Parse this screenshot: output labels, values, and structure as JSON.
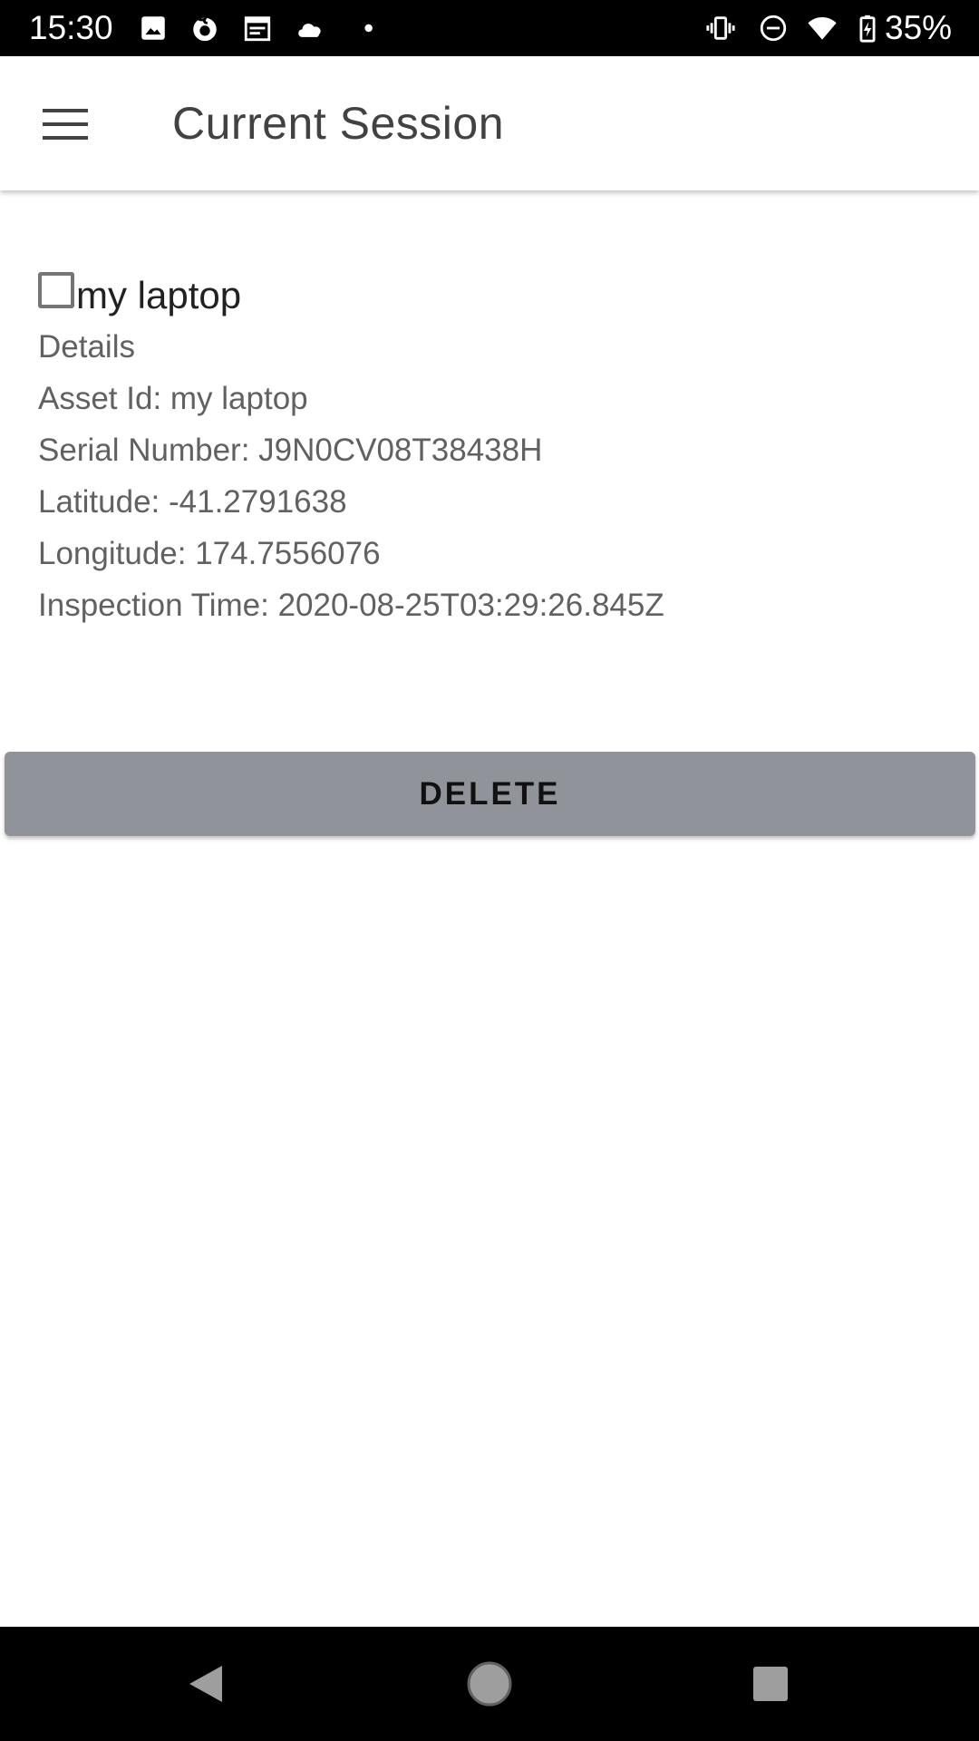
{
  "status_bar": {
    "time": "15:30",
    "battery": "35%",
    "left_icons": [
      "image-icon",
      "firefox-icon",
      "calendar-icon",
      "cloud-icon",
      "dot-icon"
    ],
    "right_icons": [
      "vibrate-icon",
      "do-not-disturb-icon",
      "wifi-icon",
      "battery-charging-icon"
    ]
  },
  "app_bar": {
    "title": "Current Session",
    "menu_icon": "menu-icon"
  },
  "asset": {
    "name": "my laptop",
    "checked": false,
    "details_heading": "Details",
    "asset_id": "Asset Id: my laptop",
    "serial_number": "Serial Number: J9N0CV08T38438H",
    "latitude": "Latitude: -41.2791638",
    "longitude": "Longitude: 174.7556076",
    "inspection_time": "Inspection Time: 2020-08-25T03:29:26.845Z"
  },
  "actions": {
    "delete_label": "DELETE"
  },
  "nav_bar": {
    "back_icon": "back-icon",
    "home_icon": "home-icon",
    "recents_icon": "recents-icon"
  },
  "colors": {
    "status_bar": "#000000",
    "app_bar": "#ffffff",
    "title_text": "#424242",
    "detail_text": "#616161",
    "delete_button": "#90939a",
    "nav_bar": "#000000"
  }
}
